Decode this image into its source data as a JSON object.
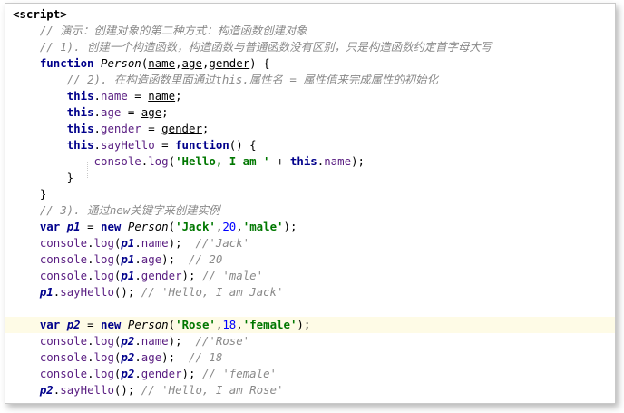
{
  "editor": {
    "lines": [
      {
        "id": "l1",
        "parts": [
          {
            "cls": "tag",
            "t": "<script>"
          }
        ]
      },
      {
        "id": "l2",
        "parts": [
          {
            "cls": "",
            "t": "    "
          },
          {
            "cls": "cm",
            "t": "// 演示：创建对象的第二种方式：构造函数创建对象"
          }
        ]
      },
      {
        "id": "l3",
        "parts": [
          {
            "cls": "",
            "t": "    "
          },
          {
            "cls": "cm",
            "t": "// 1). 创建一个构造函数，构造函数与普通函数没有区别，只是构造函数约定首字母大写"
          }
        ]
      },
      {
        "id": "l4",
        "parts": [
          {
            "cls": "",
            "t": "    "
          },
          {
            "cls": "kw",
            "t": "function"
          },
          {
            "cls": "",
            "t": " "
          },
          {
            "cls": "fn",
            "t": "Person"
          },
          {
            "cls": "",
            "t": "("
          },
          {
            "cls": "ul",
            "t": "name"
          },
          {
            "cls": "",
            "t": ","
          },
          {
            "cls": "ul",
            "t": "age"
          },
          {
            "cls": "",
            "t": ","
          },
          {
            "cls": "ul",
            "t": "gender"
          },
          {
            "cls": "",
            "t": ") {"
          }
        ]
      },
      {
        "id": "l5",
        "parts": [
          {
            "cls": "",
            "t": "        "
          },
          {
            "cls": "cm",
            "t": "// 2). 在构造函数里面通过this.属性名 = 属性值来完成属性的初始化"
          }
        ]
      },
      {
        "id": "l6",
        "parts": [
          {
            "cls": "",
            "t": "        "
          },
          {
            "cls": "kw",
            "t": "this"
          },
          {
            "cls": "",
            "t": "."
          },
          {
            "cls": "prop",
            "t": "name"
          },
          {
            "cls": "",
            "t": " = "
          },
          {
            "cls": "ul",
            "t": "name"
          },
          {
            "cls": "",
            "t": ";"
          }
        ]
      },
      {
        "id": "l7",
        "parts": [
          {
            "cls": "",
            "t": "        "
          },
          {
            "cls": "kw",
            "t": "this"
          },
          {
            "cls": "",
            "t": "."
          },
          {
            "cls": "prop",
            "t": "age"
          },
          {
            "cls": "",
            "t": " = "
          },
          {
            "cls": "ul",
            "t": "age"
          },
          {
            "cls": "",
            "t": ";"
          }
        ]
      },
      {
        "id": "l8",
        "parts": [
          {
            "cls": "",
            "t": "        "
          },
          {
            "cls": "kw",
            "t": "this"
          },
          {
            "cls": "",
            "t": "."
          },
          {
            "cls": "prop",
            "t": "gender"
          },
          {
            "cls": "",
            "t": " = "
          },
          {
            "cls": "ul",
            "t": "gender"
          },
          {
            "cls": "",
            "t": ";"
          }
        ]
      },
      {
        "id": "l9",
        "parts": [
          {
            "cls": "",
            "t": "        "
          },
          {
            "cls": "kw",
            "t": "this"
          },
          {
            "cls": "",
            "t": "."
          },
          {
            "cls": "prop",
            "t": "sayHello"
          },
          {
            "cls": "",
            "t": " = "
          },
          {
            "cls": "kw",
            "t": "function"
          },
          {
            "cls": "",
            "t": "() {"
          }
        ]
      },
      {
        "id": "l10",
        "parts": [
          {
            "cls": "",
            "t": "            "
          },
          {
            "cls": "prop",
            "t": "console"
          },
          {
            "cls": "",
            "t": "."
          },
          {
            "cls": "prop",
            "t": "log"
          },
          {
            "cls": "",
            "t": "("
          },
          {
            "cls": "str",
            "t": "'Hello, I am '"
          },
          {
            "cls": "",
            "t": " + "
          },
          {
            "cls": "kw",
            "t": "this"
          },
          {
            "cls": "",
            "t": "."
          },
          {
            "cls": "prop",
            "t": "name"
          },
          {
            "cls": "",
            "t": ");"
          }
        ]
      },
      {
        "id": "l11",
        "parts": [
          {
            "cls": "",
            "t": "        }"
          }
        ]
      },
      {
        "id": "l12",
        "parts": [
          {
            "cls": "",
            "t": "    }"
          }
        ]
      },
      {
        "id": "l13",
        "parts": [
          {
            "cls": "",
            "t": "    "
          },
          {
            "cls": "cm",
            "t": "// 3). 通过new关键字来创建实例"
          }
        ]
      },
      {
        "id": "l14",
        "parts": [
          {
            "cls": "",
            "t": "    "
          },
          {
            "cls": "kw",
            "t": "var"
          },
          {
            "cls": "",
            "t": " "
          },
          {
            "cls": "var",
            "t": "p1"
          },
          {
            "cls": "",
            "t": " = "
          },
          {
            "cls": "kw",
            "t": "new"
          },
          {
            "cls": "",
            "t": " "
          },
          {
            "cls": "fn",
            "t": "Person"
          },
          {
            "cls": "",
            "t": "("
          },
          {
            "cls": "str",
            "t": "'Jack'"
          },
          {
            "cls": "",
            "t": ","
          },
          {
            "cls": "num",
            "t": "20"
          },
          {
            "cls": "",
            "t": ","
          },
          {
            "cls": "str",
            "t": "'male'"
          },
          {
            "cls": "",
            "t": ");"
          }
        ]
      },
      {
        "id": "l15",
        "parts": [
          {
            "cls": "",
            "t": "    "
          },
          {
            "cls": "prop",
            "t": "console"
          },
          {
            "cls": "",
            "t": "."
          },
          {
            "cls": "prop",
            "t": "log"
          },
          {
            "cls": "",
            "t": "("
          },
          {
            "cls": "var",
            "t": "p1"
          },
          {
            "cls": "",
            "t": "."
          },
          {
            "cls": "prop",
            "t": "name"
          },
          {
            "cls": "",
            "t": ");  "
          },
          {
            "cls": "cm",
            "t": "//'Jack'"
          }
        ]
      },
      {
        "id": "l16",
        "parts": [
          {
            "cls": "",
            "t": "    "
          },
          {
            "cls": "prop",
            "t": "console"
          },
          {
            "cls": "",
            "t": "."
          },
          {
            "cls": "prop",
            "t": "log"
          },
          {
            "cls": "",
            "t": "("
          },
          {
            "cls": "var",
            "t": "p1"
          },
          {
            "cls": "",
            "t": "."
          },
          {
            "cls": "prop",
            "t": "age"
          },
          {
            "cls": "",
            "t": ");  "
          },
          {
            "cls": "cm",
            "t": "// 20"
          }
        ]
      },
      {
        "id": "l17",
        "parts": [
          {
            "cls": "",
            "t": "    "
          },
          {
            "cls": "prop",
            "t": "console"
          },
          {
            "cls": "",
            "t": "."
          },
          {
            "cls": "prop",
            "t": "log"
          },
          {
            "cls": "",
            "t": "("
          },
          {
            "cls": "var",
            "t": "p1"
          },
          {
            "cls": "",
            "t": "."
          },
          {
            "cls": "prop",
            "t": "gender"
          },
          {
            "cls": "",
            "t": "); "
          },
          {
            "cls": "cm",
            "t": "// 'male'"
          }
        ]
      },
      {
        "id": "l18",
        "parts": [
          {
            "cls": "",
            "t": "    "
          },
          {
            "cls": "var",
            "t": "p1"
          },
          {
            "cls": "",
            "t": "."
          },
          {
            "cls": "prop",
            "t": "sayHello"
          },
          {
            "cls": "",
            "t": "(); "
          },
          {
            "cls": "cm",
            "t": "// 'Hello, I am Jack'"
          }
        ]
      },
      {
        "id": "l19",
        "parts": [
          {
            "cls": "",
            "t": ""
          }
        ]
      },
      {
        "id": "l20",
        "hl": true,
        "parts": [
          {
            "cls": "",
            "t": "    "
          },
          {
            "cls": "kw",
            "t": "var"
          },
          {
            "cls": "",
            "t": " "
          },
          {
            "cls": "var",
            "t": "p2"
          },
          {
            "cls": "",
            "t": " = "
          },
          {
            "cls": "kw",
            "t": "new"
          },
          {
            "cls": "",
            "t": " "
          },
          {
            "cls": "fn",
            "t": "Person"
          },
          {
            "cls": "",
            "t": "("
          },
          {
            "cls": "str",
            "t": "'Rose'"
          },
          {
            "cls": "",
            "t": ","
          },
          {
            "cls": "num",
            "t": "18"
          },
          {
            "cls": "",
            "t": ","
          },
          {
            "cls": "str",
            "t": "'female'"
          },
          {
            "cls": "",
            "t": ");"
          }
        ]
      },
      {
        "id": "l21",
        "parts": [
          {
            "cls": "",
            "t": "    "
          },
          {
            "cls": "prop",
            "t": "console"
          },
          {
            "cls": "",
            "t": "."
          },
          {
            "cls": "prop",
            "t": "log"
          },
          {
            "cls": "",
            "t": "("
          },
          {
            "cls": "var",
            "t": "p2"
          },
          {
            "cls": "",
            "t": "."
          },
          {
            "cls": "prop",
            "t": "name"
          },
          {
            "cls": "",
            "t": ");  "
          },
          {
            "cls": "cm",
            "t": "//'Rose'"
          }
        ]
      },
      {
        "id": "l22",
        "parts": [
          {
            "cls": "",
            "t": "    "
          },
          {
            "cls": "prop",
            "t": "console"
          },
          {
            "cls": "",
            "t": "."
          },
          {
            "cls": "prop",
            "t": "log"
          },
          {
            "cls": "",
            "t": "("
          },
          {
            "cls": "var",
            "t": "p2"
          },
          {
            "cls": "",
            "t": "."
          },
          {
            "cls": "prop",
            "t": "age"
          },
          {
            "cls": "",
            "t": ");  "
          },
          {
            "cls": "cm",
            "t": "// 18"
          }
        ]
      },
      {
        "id": "l23",
        "parts": [
          {
            "cls": "",
            "t": "    "
          },
          {
            "cls": "prop",
            "t": "console"
          },
          {
            "cls": "",
            "t": "."
          },
          {
            "cls": "prop",
            "t": "log"
          },
          {
            "cls": "",
            "t": "("
          },
          {
            "cls": "var",
            "t": "p2"
          },
          {
            "cls": "",
            "t": "."
          },
          {
            "cls": "prop",
            "t": "gender"
          },
          {
            "cls": "",
            "t": "); "
          },
          {
            "cls": "cm",
            "t": "// 'female'"
          }
        ]
      },
      {
        "id": "l24",
        "parts": [
          {
            "cls": "",
            "t": "    "
          },
          {
            "cls": "var",
            "t": "p2"
          },
          {
            "cls": "",
            "t": "."
          },
          {
            "cls": "prop",
            "t": "sayHello"
          },
          {
            "cls": "",
            "t": "(); "
          },
          {
            "cls": "cm",
            "t": "// 'Hello, I am Rose'"
          }
        ]
      }
    ]
  }
}
